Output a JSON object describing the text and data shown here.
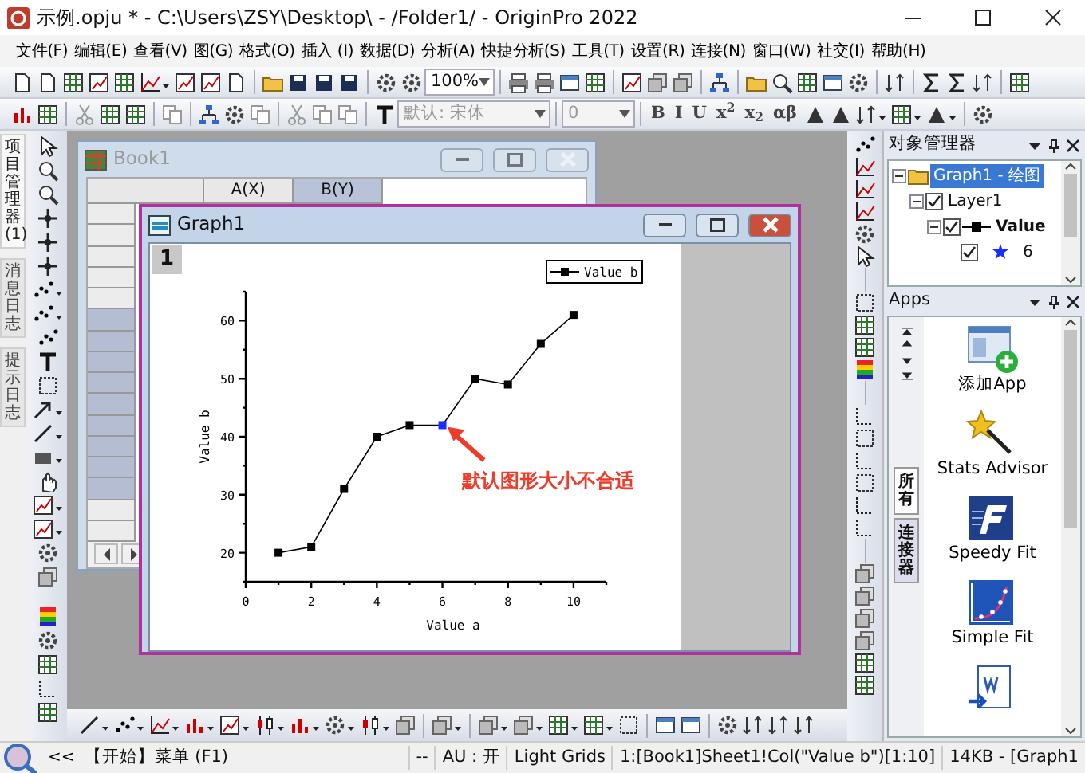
{
  "window": {
    "title": "示例.opju * - C:\\Users\\ZSY\\Desktop\\ - /Folder1/ - OriginPro 2022"
  },
  "menu": [
    "文件(F)",
    "编辑(E)",
    "查看(V)",
    "图(G)",
    "格式(O)",
    "插入 (I)",
    "数据(D)",
    "分析(A)",
    "快捷分析(S)",
    "工具(T)",
    "设置(R)",
    "连接(N)",
    "窗口(W)",
    "社交(I)",
    "帮助(H)"
  ],
  "toolbar": {
    "zoom": {
      "value": "100%",
      "disabled": false
    },
    "font": {
      "value": "默认: 宋体",
      "disabled": true
    },
    "font_size": {
      "value": "0",
      "disabled": true
    },
    "format_buttons": [
      "B",
      "I",
      "U",
      "x$^{2}$",
      "x$_{2}$",
      "αβ"
    ]
  },
  "side_tabs": [
    {
      "label": "项目管理器 (1)",
      "selected": true
    },
    {
      "label": "消息日志",
      "selected": false
    },
    {
      "label": "提示日志",
      "selected": false
    }
  ],
  "book": {
    "title": "Book1",
    "columns": [
      {
        "label": "A(X)",
        "selected": false
      },
      {
        "label": "B(Y)",
        "selected": true
      }
    ],
    "rows": [
      {
        "selected": false
      },
      {
        "selected": false
      },
      {
        "selected": false
      },
      {
        "selected": false
      },
      {
        "selected": false
      },
      {
        "selected": true
      },
      {
        "selected": true
      },
      {
        "selected": true
      },
      {
        "selected": true
      },
      {
        "selected": true
      },
      {
        "selected": true
      },
      {
        "selected": true
      },
      {
        "selected": true
      },
      {
        "selected": true
      },
      {
        "selected": false
      },
      {
        "selected": false
      }
    ]
  },
  "graph": {
    "title": "Graph1",
    "layer": "1",
    "chart_data": {
      "type": "line",
      "xlabel": "Value a",
      "ylabel": "Value b",
      "x": [
        1,
        2,
        3,
        4,
        5,
        6,
        7,
        8,
        9,
        10
      ],
      "series": [
        {
          "name": "Value b",
          "color": "#000000",
          "marker": "square",
          "values": [
            20,
            21,
            31,
            40,
            42,
            42,
            50,
            49,
            56,
            61
          ]
        }
      ],
      "xlim": [
        0,
        11
      ],
      "ylim": [
        15,
        65
      ],
      "xticks": [
        0,
        2,
        4,
        6,
        8,
        10
      ],
      "yticks": [
        20,
        30,
        40,
        50,
        60
      ],
      "annotations": [
        {
          "text": "默认图形大小不合适",
          "x": 6,
          "y": 42
        }
      ]
    }
  },
  "object_manager": {
    "title": "对象管理器",
    "tree": [
      {
        "label": "Graph1 - 绘图",
        "selected": true,
        "expanded": true,
        "children": [
          {
            "label": "Layer1",
            "checked": true,
            "expanded": true,
            "children": [
              {
                "label": "Value",
                "checked": true,
                "expanded": true,
                "children": [
                  {
                    "label": "6",
                    "checked": true
                  }
                ]
              }
            ]
          }
        ]
      }
    ]
  },
  "apps": {
    "title": "Apps",
    "tabs": [
      {
        "label": "所有",
        "selected": true
      },
      {
        "label": "连接器",
        "selected": false
      }
    ],
    "items": [
      {
        "kind": "add",
        "label": "添加App"
      },
      {
        "kind": "wand",
        "label": "Stats Advisor"
      },
      {
        "kind": "speedy",
        "label": "Speedy Fit"
      },
      {
        "kind": "simple",
        "label": "Simple Fit"
      },
      {
        "kind": "word"
      }
    ]
  },
  "status_bar": {
    "back": "<<",
    "hint": "【开始】菜单 (F1)",
    "segments": [
      "--",
      "AU : 开",
      "Light Grids",
      "1:[Book1]Sheet1!Col(\"Value b\")[1:10]",
      "14KB - [Graph1"
    ]
  }
}
